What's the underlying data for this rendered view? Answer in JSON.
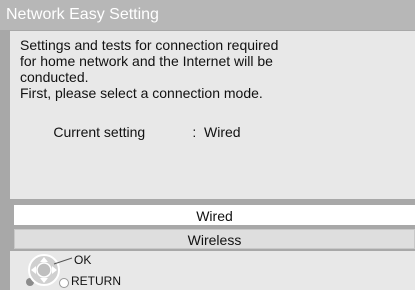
{
  "title": "Network Easy Setting",
  "message": {
    "lines": [
      "Settings and tests for connection required",
      "for home network and the Internet will be",
      "conducted.",
      "First, please select a connection mode."
    ],
    "current_label": "Current setting",
    "current_separator": ":",
    "current_value": "Wired"
  },
  "options": [
    {
      "label": "Wired",
      "selected": true
    },
    {
      "label": "Wireless",
      "selected": false
    }
  ],
  "footer": {
    "ok_label": "OK",
    "return_label": "RETURN",
    "nav_icon": "dpad-icon",
    "return_icon": "return-button-icon"
  }
}
